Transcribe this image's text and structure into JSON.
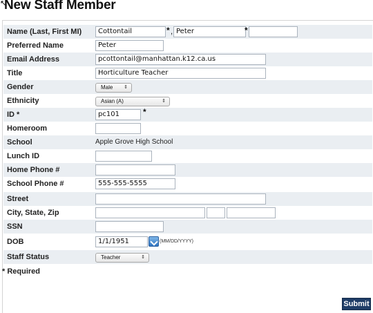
{
  "page": {
    "title": "New Staff Member",
    "required_note": "* Required",
    "submit_label": "Submit"
  },
  "fields": {
    "name": {
      "label": "Name (Last, First MI)",
      "last": "Cottontail",
      "first": "Peter",
      "middle": "",
      "required_marker": "*",
      "separator": ","
    },
    "preferred_name": {
      "label": "Preferred Name",
      "value": "Peter"
    },
    "email": {
      "label": "Email Address",
      "value": "pcottontail@manhattan.k12.ca.us"
    },
    "title": {
      "label": "Title",
      "value": "Horticulture Teacher"
    },
    "gender": {
      "label": "Gender",
      "selected": "Male"
    },
    "ethnicity": {
      "label": "Ethnicity",
      "selected": "Asian (A)"
    },
    "id": {
      "label": "ID *",
      "value": "pc101",
      "required_marker": "*"
    },
    "homeroom": {
      "label": "Homeroom",
      "value": ""
    },
    "school": {
      "label": "School",
      "value": "Apple Grove High School"
    },
    "lunch_id": {
      "label": "Lunch ID",
      "value": ""
    },
    "home_phone": {
      "label": "Home Phone #",
      "value": ""
    },
    "school_phone": {
      "label": "School Phone #",
      "value": "555-555-5555"
    },
    "street": {
      "label": "Street",
      "value": ""
    },
    "city_state_zip": {
      "label": "City, State, Zip",
      "city": "",
      "state": "",
      "zip": ""
    },
    "ssn": {
      "label": "SSN",
      "value": ""
    },
    "dob": {
      "label": "DOB",
      "value": "1/1/1951",
      "format_hint": "(MM/DD/YYYY)",
      "icon": "calendar-icon"
    },
    "staff_status": {
      "label": "Staff Status",
      "selected": "Teacher"
    }
  },
  "icons": {
    "select_arrow": "⇕"
  },
  "colors": {
    "row_shade": "#eaeef2",
    "submit_bg": "#1f3d67"
  }
}
